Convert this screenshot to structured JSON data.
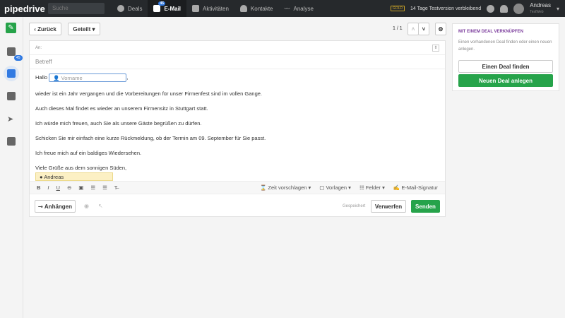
{
  "topbar": {
    "logo": "pipedrive",
    "search_placeholder": "Suche",
    "nav": [
      {
        "label": "Deals"
      },
      {
        "label": "E-Mail",
        "badge": "45"
      },
      {
        "label": "Aktivitäten"
      },
      {
        "label": "Kontakte"
      },
      {
        "label": "Analyse"
      }
    ],
    "plan": "GOLD",
    "trial": "14 Tage Testversion verbleibend",
    "user": {
      "name": "Andreas",
      "sub": "TestWeb"
    }
  },
  "sidebar": {
    "badge": "45"
  },
  "toolbar": {
    "back": "Zurück",
    "shared": "Geteilt",
    "pager": "1 / 1"
  },
  "email": {
    "to_label": "An:",
    "subject_placeholder": "Betreff",
    "greeting": "Hallo",
    "var_placeholder": "Vorname",
    "paragraphs": [
      "wieder ist ein Jahr vergangen und die Vorbereitungen für unser Firmenfest sind im vollen Gange.",
      "Auch dieses Mal findet es wieder an unserem Firmensitz in Stuttgart statt.",
      "Ich würde mich freuen, auch Sie als unsere Gäste begrüßen zu dürfen.",
      "Schicken Sie mir einfach eine kurze Rückmeldung, ob der Termin am 09. September für Sie passt.",
      "Ich freue mich auf ein baldiges Wiedersehen."
    ],
    "closing": "Viele Grüße aus dem sonnigen Süden,",
    "signature": "Andreas"
  },
  "editor": {
    "time": "Zeit vorschlagen",
    "templates": "Vorlagen",
    "fields": "Felder",
    "signature": "E-Mail-Signatur"
  },
  "footer": {
    "attach": "Anhängen",
    "saved": "Gespeichert",
    "discard": "Verwerfen",
    "send": "Senden"
  },
  "deal": {
    "title": "MIT EINEM DEAL VERKNÜPFEN",
    "desc": "Einen vorhandenen Deal finden oder einen neuen anlegen.",
    "find": "Einen Deal finden",
    "create": "Neuen Deal anlegen"
  },
  "colors": {
    "green": "#26a34a",
    "topbar": "#26292c",
    "blue": "#317ae2"
  }
}
